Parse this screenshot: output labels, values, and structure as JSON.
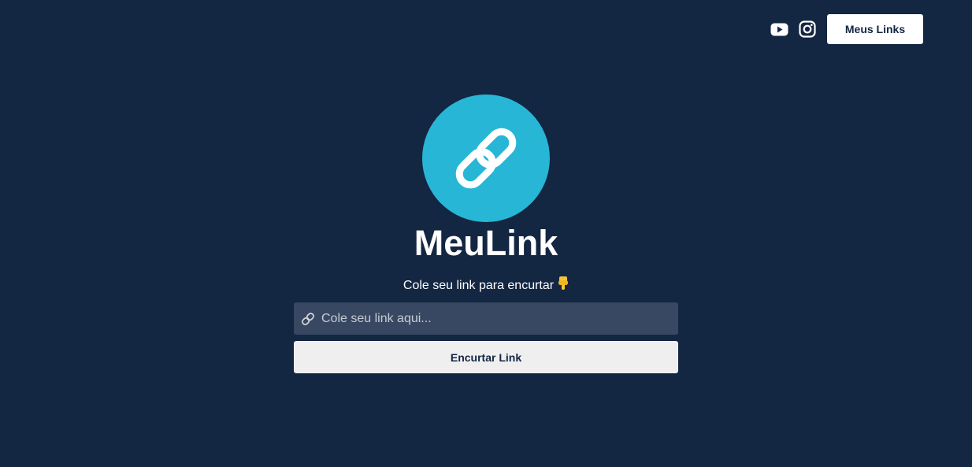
{
  "header": {
    "youtube_icon": "youtube-icon",
    "instagram_icon": "instagram-icon",
    "meus_links_label": "Meus Links"
  },
  "logo": {
    "icon": "chain-link-icon",
    "circle_color": "#28b6d6"
  },
  "hero": {
    "title": "MeuLink",
    "subtitle": "Cole seu link para encurtar",
    "subtitle_emoji": "👇"
  },
  "form": {
    "input_icon": "link-icon",
    "input_value": "",
    "input_placeholder": "Cole seu link aqui...",
    "submit_label": "Encurtar Link"
  },
  "colors": {
    "background": "#132642",
    "input_background": "#384862",
    "button_background": "#f0eff0",
    "accent": "#28b6d6"
  }
}
